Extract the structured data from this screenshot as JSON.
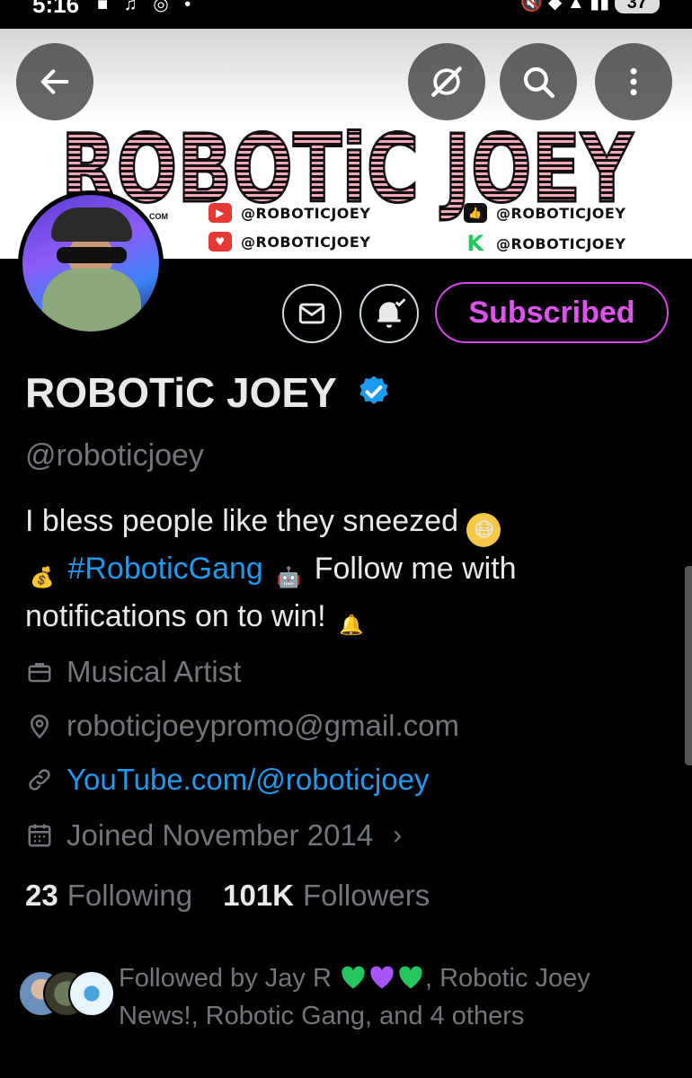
{
  "status_bar": {
    "time": "5:16",
    "battery": "37"
  },
  "banner": {
    "title": "ROBOTiC JOEY",
    "com_tag": "COM",
    "socials": [
      {
        "platform": "youtube",
        "handle": "@ROBOTICJOEY",
        "color": "#e53935"
      },
      {
        "platform": "likee",
        "handle": "@ROBOTICJOEY",
        "color": "#e53935"
      },
      {
        "platform": "like",
        "handle": "@ROBOTICJOEY",
        "color": "#111111"
      },
      {
        "platform": "kick",
        "handle": "@ROBOTICJOEY",
        "color": "#22c55e"
      }
    ]
  },
  "nav": {
    "back_icon": "arrow-left-icon",
    "grok_icon": "grok-icon",
    "search_icon": "search-icon",
    "more_icon": "more-vertical-icon"
  },
  "profile": {
    "display_name": "ROBOTiC JOEY",
    "handle": "@roboticjoey",
    "subscribe_label": "Subscribed",
    "verified_color": "#1d9bf0",
    "bio_line1": "I bless people like they sneezed",
    "bio_hashtag": "#RoboticGang",
    "bio_line2": " Follow me with",
    "bio_line3": "notifications on to win!",
    "category": "Musical Artist",
    "location": "roboticjoeypromo@gmail.com",
    "website": "YouTube.com/@roboticjoey",
    "joined": "Joined November 2014",
    "following_count": "23",
    "following_label": "Following",
    "followers_count": "101K",
    "followers_label": "Followers",
    "followed_by_prefix": "Followed by Jay R",
    "followed_by_suffix": ", Robotic Joey News!, Robotic Gang, and 4 others"
  },
  "colors": {
    "accent": "#1d9bf0",
    "subscribe": "#d946ef",
    "muted": "#71767b"
  }
}
